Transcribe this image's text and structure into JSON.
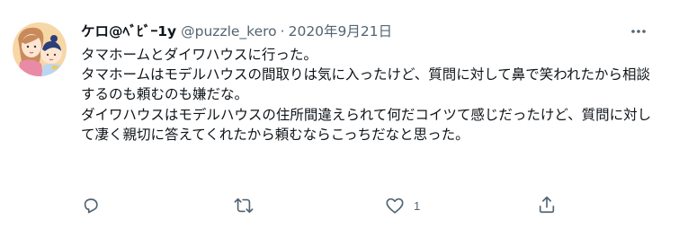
{
  "tweet": {
    "display_name": "ケロ@ﾍﾞﾋﾞｰ1y",
    "handle": "@puzzle_kero",
    "separator": "·",
    "date": "2020年9月21日",
    "lines": [
      "タマホームとダイワハウスに行った。",
      "タマホームはモデルハウスの間取りは気に入ったけど、質問に対して鼻で笑われたから相談するのも頼むのも嫌だな。",
      "ダイワハウスはモデルハウスの住所間違えられて何だコイツて感じだったけど、質問に対して凄く親切に答えてくれたから頼むならこっちだなと思った。"
    ],
    "actions": {
      "reply_icon": "reply-icon",
      "retweet_icon": "retweet-icon",
      "like_icon": "heart-icon",
      "like_count": "1",
      "share_icon": "share-icon"
    },
    "more_icon": "more-icon",
    "colors": {
      "text": "#0f1419",
      "secondary": "#536471",
      "avatar_bg": "#f6d7a6",
      "background": "#ffffff"
    }
  }
}
